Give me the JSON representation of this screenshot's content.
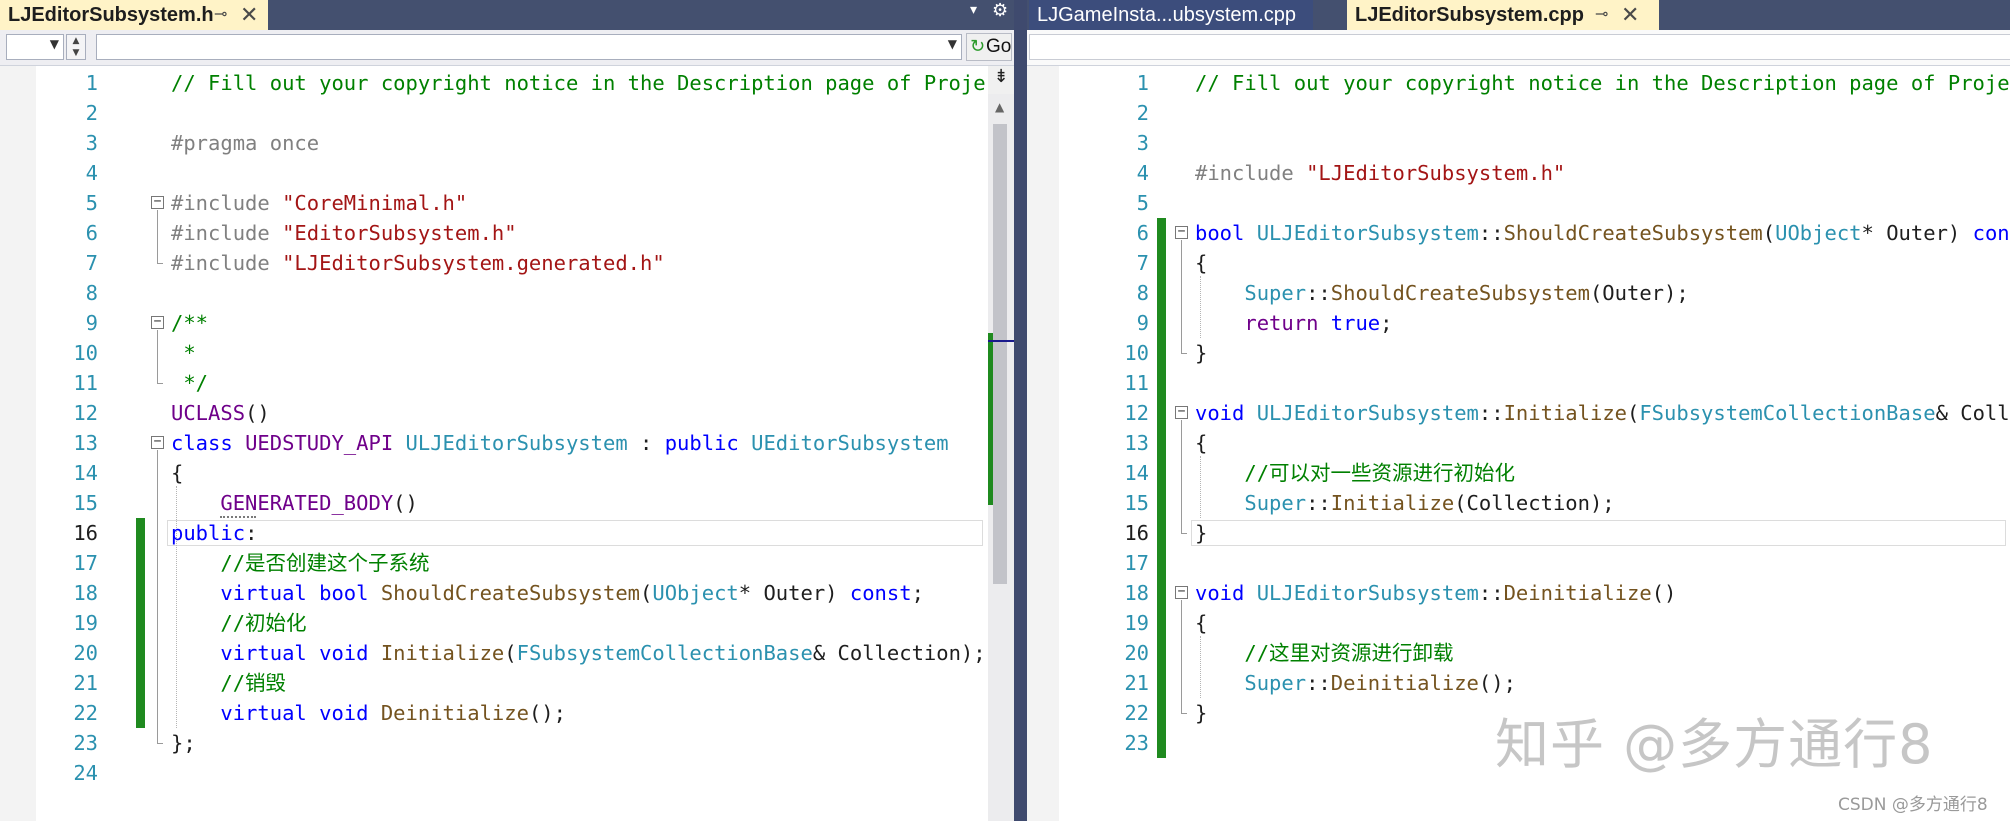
{
  "left_pane": {
    "tabs": [
      {
        "label": "LJEditorSubsystem.h",
        "active": true,
        "pin_icon": "pin-icon",
        "close_icon": "close-icon"
      }
    ],
    "tabstrip_icons": [
      "dropdown-arrow-icon",
      "gear-icon"
    ],
    "navbar": {
      "go_label": "Go"
    },
    "lines": [
      {
        "n": "1",
        "tokens": [
          {
            "t": "// Fill out your copyright notice in the Description page of Projec",
            "c": "com"
          }
        ]
      },
      {
        "n": "2",
        "tokens": []
      },
      {
        "n": "3",
        "tokens": [
          {
            "t": "#pragma once",
            "c": "pp"
          }
        ]
      },
      {
        "n": "4",
        "tokens": []
      },
      {
        "n": "5",
        "tokens": [
          {
            "t": "#include ",
            "c": "pp"
          },
          {
            "t": "\"CoreMinimal.h\"",
            "c": "str"
          }
        ]
      },
      {
        "n": "6",
        "tokens": [
          {
            "t": "#include ",
            "c": "pp"
          },
          {
            "t": "\"EditorSubsystem.h\"",
            "c": "str"
          }
        ]
      },
      {
        "n": "7",
        "tokens": [
          {
            "t": "#include ",
            "c": "pp"
          },
          {
            "t": "\"LJEditorSubsystem.generated.h\"",
            "c": "str"
          }
        ]
      },
      {
        "n": "8",
        "tokens": []
      },
      {
        "n": "9",
        "tokens": [
          {
            "t": "/**",
            "c": "com"
          }
        ]
      },
      {
        "n": "10",
        "tokens": [
          {
            "t": " *",
            "c": "com"
          }
        ]
      },
      {
        "n": "11",
        "tokens": [
          {
            "t": " */",
            "c": "com"
          }
        ]
      },
      {
        "n": "12",
        "tokens": [
          {
            "t": "UCLASS",
            "c": "mac"
          },
          {
            "t": "()",
            "c": "plain"
          }
        ]
      },
      {
        "n": "13",
        "tokens": [
          {
            "t": "class ",
            "c": "kw"
          },
          {
            "t": "UEDSTUDY_API ",
            "c": "mac"
          },
          {
            "t": "ULJEditorSubsystem",
            "c": "type"
          },
          {
            "t": " : ",
            "c": "plain"
          },
          {
            "t": "public ",
            "c": "kw"
          },
          {
            "t": "UEditorSubsystem",
            "c": "type"
          }
        ]
      },
      {
        "n": "14",
        "tokens": [
          {
            "t": "{",
            "c": "plain"
          }
        ]
      },
      {
        "n": "15",
        "tokens": [
          {
            "t": "    ",
            "c": "plain"
          },
          {
            "t": "GENERATED_BODY",
            "c": "mac"
          },
          {
            "t": "()",
            "c": "plain"
          }
        ]
      },
      {
        "n": "16",
        "tokens": [
          {
            "t": "public",
            "c": "kw"
          },
          {
            "t": ":",
            "c": "plain"
          }
        ]
      },
      {
        "n": "17",
        "tokens": [
          {
            "t": "    ",
            "c": "plain"
          },
          {
            "t": "//是否创建这个子系统",
            "c": "com"
          }
        ]
      },
      {
        "n": "18",
        "tokens": [
          {
            "t": "    ",
            "c": "plain"
          },
          {
            "t": "virtual ",
            "c": "kw"
          },
          {
            "t": "bool ",
            "c": "kw"
          },
          {
            "t": "ShouldCreateSubsystem",
            "c": "fn"
          },
          {
            "t": "(",
            "c": "plain"
          },
          {
            "t": "UObject",
            "c": "type"
          },
          {
            "t": "* Outer) ",
            "c": "plain"
          },
          {
            "t": "const",
            "c": "kw"
          },
          {
            "t": ";",
            "c": "plain"
          }
        ]
      },
      {
        "n": "19",
        "tokens": [
          {
            "t": "    ",
            "c": "plain"
          },
          {
            "t": "//初始化",
            "c": "com"
          }
        ]
      },
      {
        "n": "20",
        "tokens": [
          {
            "t": "    ",
            "c": "plain"
          },
          {
            "t": "virtual ",
            "c": "kw"
          },
          {
            "t": "void ",
            "c": "kw"
          },
          {
            "t": "Initialize",
            "c": "fn"
          },
          {
            "t": "(",
            "c": "plain"
          },
          {
            "t": "FSubsystemCollectionBase",
            "c": "type"
          },
          {
            "t": "& Collection);",
            "c": "plain"
          }
        ]
      },
      {
        "n": "21",
        "tokens": [
          {
            "t": "    ",
            "c": "plain"
          },
          {
            "t": "//销毁",
            "c": "com"
          }
        ]
      },
      {
        "n": "22",
        "tokens": [
          {
            "t": "    ",
            "c": "plain"
          },
          {
            "t": "virtual ",
            "c": "kw"
          },
          {
            "t": "void ",
            "c": "kw"
          },
          {
            "t": "Deinitialize",
            "c": "fn"
          },
          {
            "t": "();",
            "c": "plain"
          }
        ]
      },
      {
        "n": "23",
        "tokens": [
          {
            "t": "};",
            "c": "plain"
          }
        ]
      },
      {
        "n": "24",
        "tokens": []
      }
    ]
  },
  "right_pane": {
    "tabs": [
      {
        "label": "LJGameInsta...ubsystem.cpp",
        "active": false
      },
      {
        "label": "LJEditorSubsystem.cpp",
        "active": true,
        "pin_icon": "pin-icon",
        "close_icon": "close-icon"
      }
    ],
    "lines": [
      {
        "n": "1",
        "tokens": [
          {
            "t": "// Fill out your copyright notice in the Description page of Projec",
            "c": "com"
          }
        ]
      },
      {
        "n": "2",
        "tokens": []
      },
      {
        "n": "3",
        "tokens": []
      },
      {
        "n": "4",
        "tokens": [
          {
            "t": "#include ",
            "c": "pp"
          },
          {
            "t": "\"LJEditorSubsystem.h\"",
            "c": "str"
          }
        ]
      },
      {
        "n": "5",
        "tokens": []
      },
      {
        "n": "6",
        "tokens": [
          {
            "t": "bool ",
            "c": "kw"
          },
          {
            "t": "ULJEditorSubsystem",
            "c": "type"
          },
          {
            "t": "::",
            "c": "plain"
          },
          {
            "t": "ShouldCreateSubsystem",
            "c": "fn"
          },
          {
            "t": "(",
            "c": "plain"
          },
          {
            "t": "UObject",
            "c": "type"
          },
          {
            "t": "* Outer) ",
            "c": "plain"
          },
          {
            "t": "cons",
            "c": "kw"
          }
        ]
      },
      {
        "n": "7",
        "tokens": [
          {
            "t": "{",
            "c": "plain"
          }
        ]
      },
      {
        "n": "8",
        "tokens": [
          {
            "t": "    ",
            "c": "plain"
          },
          {
            "t": "Super",
            "c": "type"
          },
          {
            "t": "::",
            "c": "plain"
          },
          {
            "t": "ShouldCreateSubsystem",
            "c": "fn"
          },
          {
            "t": "(Outer);",
            "c": "plain"
          }
        ]
      },
      {
        "n": "9",
        "tokens": [
          {
            "t": "    ",
            "c": "plain"
          },
          {
            "t": "return ",
            "c": "mac"
          },
          {
            "t": "true",
            "c": "kw"
          },
          {
            "t": ";",
            "c": "plain"
          }
        ]
      },
      {
        "n": "10",
        "tokens": [
          {
            "t": "}",
            "c": "plain"
          }
        ]
      },
      {
        "n": "11",
        "tokens": []
      },
      {
        "n": "12",
        "tokens": [
          {
            "t": "void ",
            "c": "kw"
          },
          {
            "t": "ULJEditorSubsystem",
            "c": "type"
          },
          {
            "t": "::",
            "c": "plain"
          },
          {
            "t": "Initialize",
            "c": "fn"
          },
          {
            "t": "(",
            "c": "plain"
          },
          {
            "t": "FSubsystemCollectionBase",
            "c": "type"
          },
          {
            "t": "& Colle",
            "c": "plain"
          }
        ]
      },
      {
        "n": "13",
        "tokens": [
          {
            "t": "{",
            "c": "plain"
          }
        ]
      },
      {
        "n": "14",
        "tokens": [
          {
            "t": "    ",
            "c": "plain"
          },
          {
            "t": "//可以对一些资源进行初始化",
            "c": "com"
          }
        ]
      },
      {
        "n": "15",
        "tokens": [
          {
            "t": "    ",
            "c": "plain"
          },
          {
            "t": "Super",
            "c": "type"
          },
          {
            "t": "::",
            "c": "plain"
          },
          {
            "t": "Initialize",
            "c": "fn"
          },
          {
            "t": "(Collection);",
            "c": "plain"
          }
        ]
      },
      {
        "n": "16",
        "tokens": [
          {
            "t": "}",
            "c": "plain"
          }
        ]
      },
      {
        "n": "17",
        "tokens": []
      },
      {
        "n": "18",
        "tokens": [
          {
            "t": "void ",
            "c": "kw"
          },
          {
            "t": "ULJEditorSubsystem",
            "c": "type"
          },
          {
            "t": "::",
            "c": "plain"
          },
          {
            "t": "Deinitialize",
            "c": "fn"
          },
          {
            "t": "()",
            "c": "plain"
          }
        ]
      },
      {
        "n": "19",
        "tokens": [
          {
            "t": "{",
            "c": "plain"
          }
        ]
      },
      {
        "n": "20",
        "tokens": [
          {
            "t": "    ",
            "c": "plain"
          },
          {
            "t": "//这里对资源进行卸载",
            "c": "com"
          }
        ]
      },
      {
        "n": "21",
        "tokens": [
          {
            "t": "    ",
            "c": "plain"
          },
          {
            "t": "Super",
            "c": "type"
          },
          {
            "t": "::",
            "c": "plain"
          },
          {
            "t": "Deinitialize",
            "c": "fn"
          },
          {
            "t": "();",
            "c": "plain"
          }
        ]
      },
      {
        "n": "22",
        "tokens": [
          {
            "t": "}",
            "c": "plain"
          }
        ]
      },
      {
        "n": "23",
        "tokens": []
      }
    ]
  },
  "current_line": "16",
  "watermark": "知乎 @多方通行8",
  "watermark_small": "CSDN @多方通行8",
  "colors": {
    "keyword": "#0000ff",
    "type": "#2b91af",
    "string": "#a31515",
    "comment": "#008000",
    "preprocessor": "#808080",
    "macro": "#6f008a",
    "function": "#74531f",
    "change_bar": "#1f8a1f",
    "active_tab": "#fff3c7",
    "tabstrip": "#44506f"
  }
}
